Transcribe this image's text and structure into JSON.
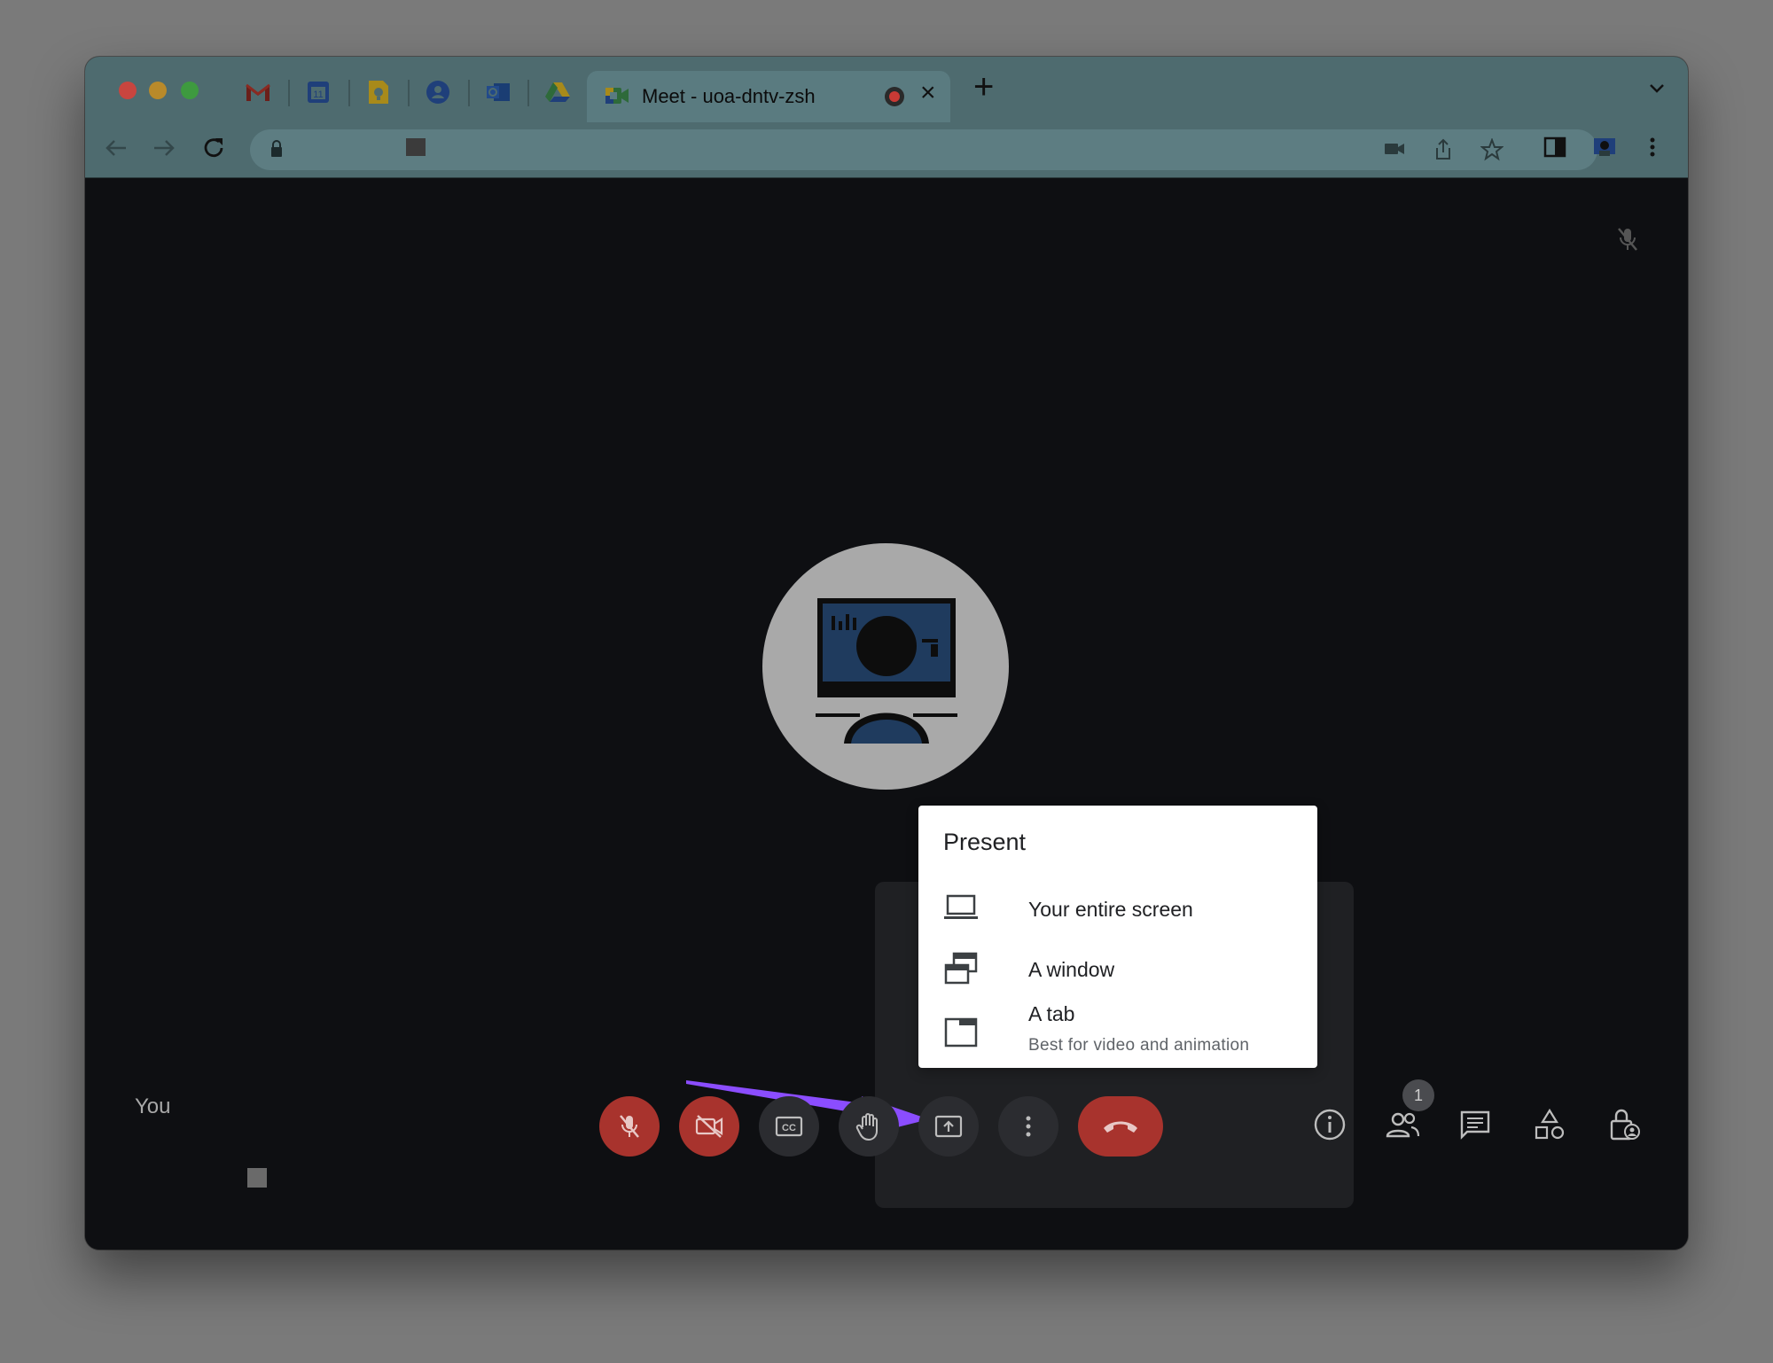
{
  "browser": {
    "pinned_tabs": [
      "gmail-icon",
      "calendar-icon",
      "keep-icon",
      "contacts-icon",
      "outlook-icon",
      "drive-icon"
    ],
    "calendar_day": "11",
    "active_tab": {
      "title": "Meet - uoa-dntv-zsh",
      "recording": true
    },
    "new_tab_label": "+"
  },
  "meet": {
    "self_label": "You",
    "present_menu": {
      "title": "Present",
      "items": [
        {
          "label": "Your entire screen",
          "subtitle": ""
        },
        {
          "label": "A window",
          "subtitle": ""
        },
        {
          "label": "A tab",
          "subtitle": "Best for video and animation"
        }
      ]
    },
    "participants_count": "1"
  },
  "colors": {
    "accent_arrow": "#8b4dff",
    "danger": "#a8332d"
  }
}
